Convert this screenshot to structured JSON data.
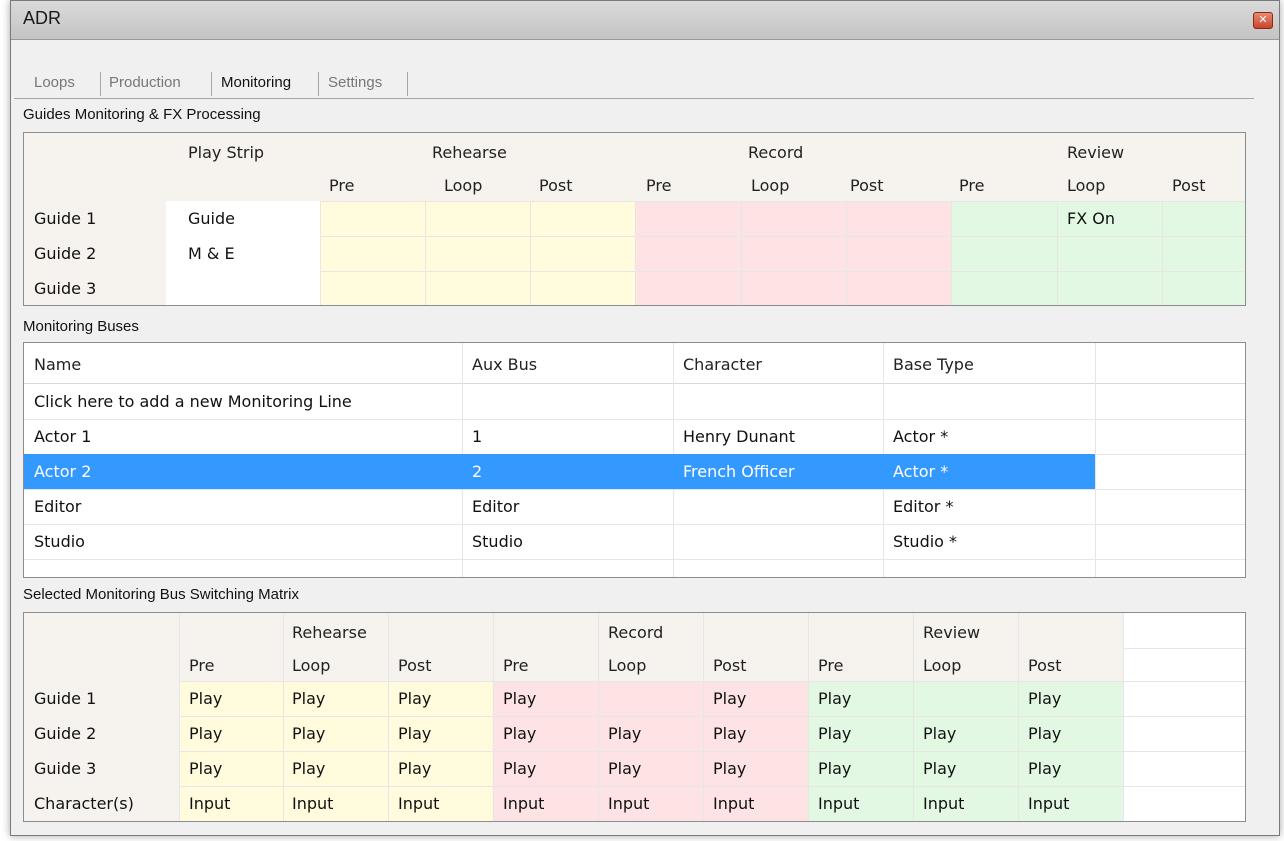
{
  "window": {
    "title": "ADR"
  },
  "tabs": [
    "Loops",
    "Production",
    "Monitoring",
    "Settings"
  ],
  "guides_section": {
    "label": "Guides Monitoring & FX Processing",
    "groups": [
      "Play Strip",
      "Rehearse",
      "Record",
      "Review"
    ],
    "subheaders": [
      "Pre",
      "Loop",
      "Post",
      "Pre",
      "Loop",
      "Post",
      "Pre",
      "Loop",
      "Post"
    ],
    "rows": [
      {
        "name": "Guide 1",
        "play_strip": "Guide",
        "review_loop": "FX On"
      },
      {
        "name": "Guide 2",
        "play_strip": "M & E",
        "review_loop": ""
      },
      {
        "name": "Guide 3",
        "play_strip": "",
        "review_loop": ""
      }
    ]
  },
  "buses_section": {
    "label": "Monitoring Buses",
    "columns": [
      "Name",
      "Aux Bus",
      "Character",
      "Base Type"
    ],
    "add_line": "Click here to add a new Monitoring Line",
    "rows": [
      {
        "name": "Actor 1",
        "aux": "1",
        "character": "Henry Dunant",
        "base": "Actor *"
      },
      {
        "name": "Actor 2",
        "aux": "2",
        "character": "French Officer",
        "base": "Actor *"
      },
      {
        "name": "Editor",
        "aux": "Editor",
        "character": "",
        "base": "Editor *"
      },
      {
        "name": "Studio",
        "aux": "Studio",
        "character": "",
        "base": "Studio *"
      }
    ],
    "selected_row": 1
  },
  "matrix_section": {
    "label": "Selected Monitoring Bus Switching Matrix",
    "groups": [
      "Rehearse",
      "Record",
      "Review"
    ],
    "subheaders": [
      "Pre",
      "Loop",
      "Post",
      "Pre",
      "Loop",
      "Post",
      "Pre",
      "Loop",
      "Post"
    ],
    "rows": [
      {
        "name": "Guide 1",
        "cells": [
          "Play",
          "Play",
          "Play",
          "Play",
          "",
          "Play",
          "Play",
          "",
          "Play"
        ]
      },
      {
        "name": "Guide 2",
        "cells": [
          "Play",
          "Play",
          "Play",
          "Play",
          "Play",
          "Play",
          "Play",
          "Play",
          "Play"
        ]
      },
      {
        "name": "Guide 3",
        "cells": [
          "Play",
          "Play",
          "Play",
          "Play",
          "Play",
          "Play",
          "Play",
          "Play",
          "Play"
        ]
      },
      {
        "name": "Character(s)",
        "cells": [
          "Input",
          "Input",
          "Input",
          "Input",
          "Input",
          "Input",
          "Input",
          "Input",
          "Input"
        ]
      }
    ]
  },
  "colors": {
    "rehearse": "#fffbdc",
    "record": "#fde3e3",
    "review": "#e3f8e3",
    "selection": "#3399ff"
  }
}
